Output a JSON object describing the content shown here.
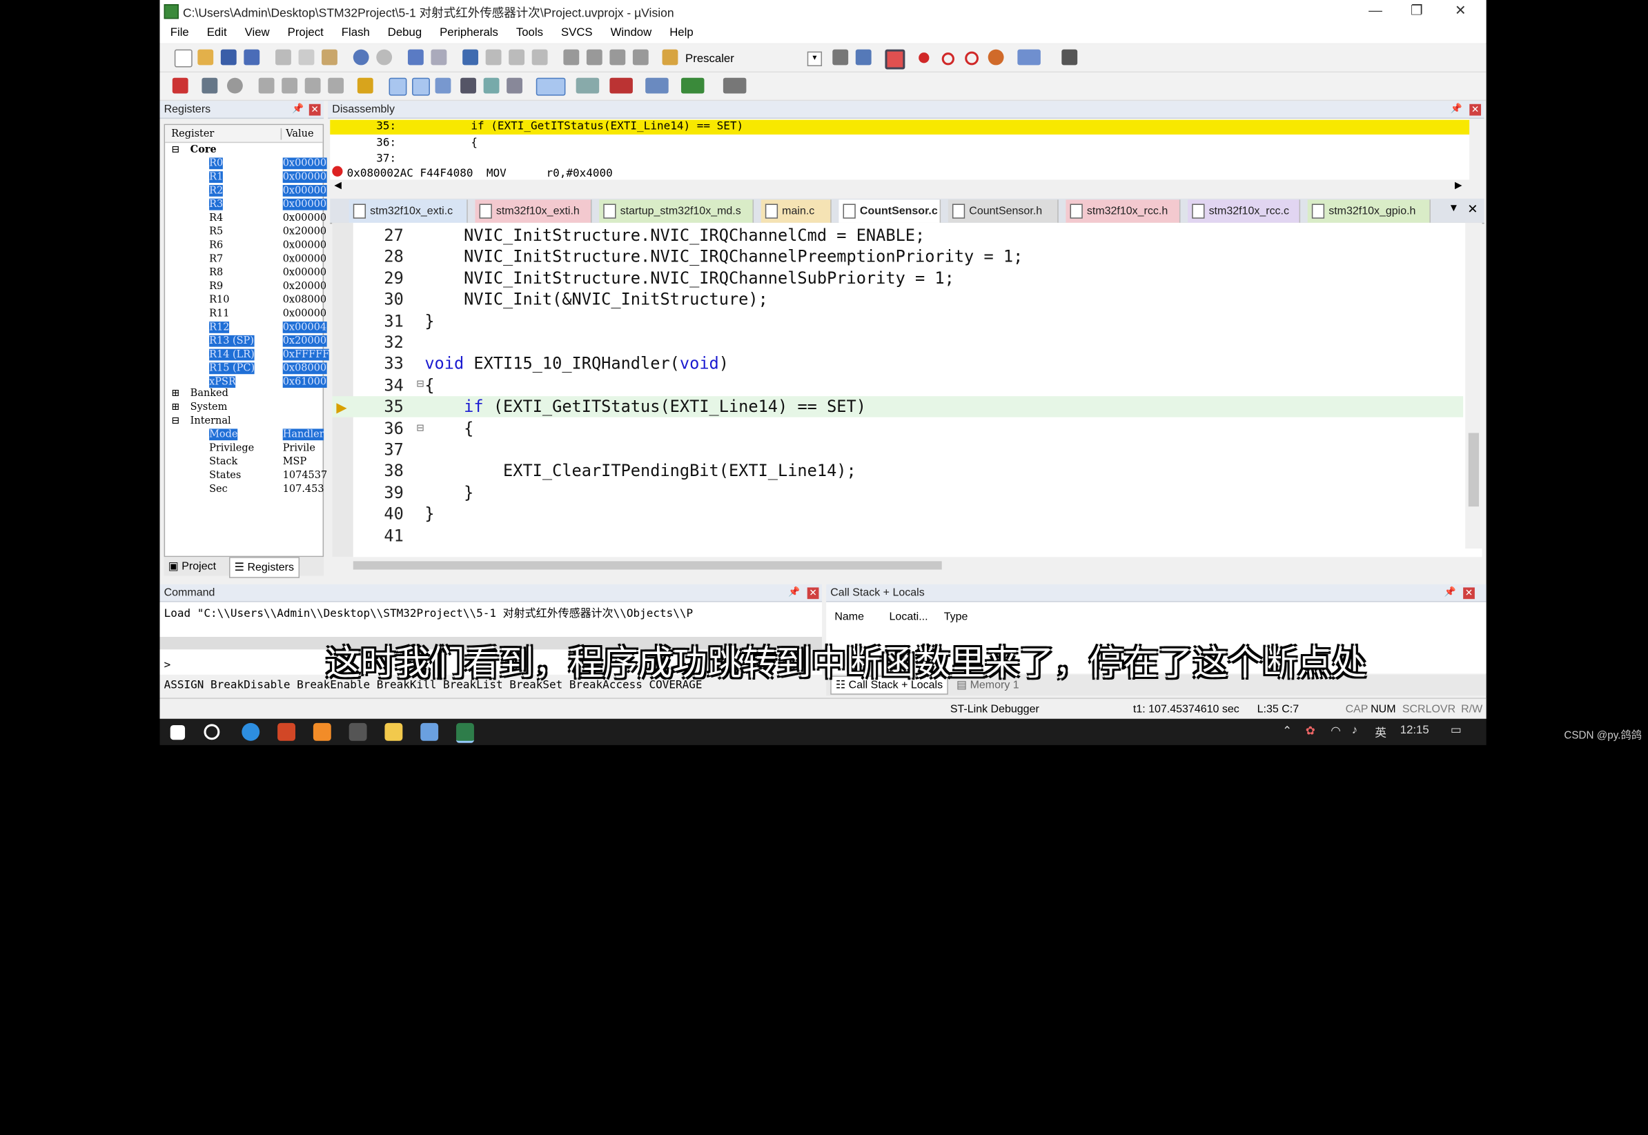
{
  "window": {
    "title": "C:\\Users\\Admin\\Desktop\\STM32Project\\5-1 对射式红外传感器计次\\Project.uvprojx - µVision",
    "minimize": "—",
    "maximize": "❐",
    "close": "✕"
  },
  "menu": [
    "File",
    "Edit",
    "View",
    "Project",
    "Flash",
    "Debug",
    "Peripherals",
    "Tools",
    "SVCS",
    "Window",
    "Help"
  ],
  "toolbar": {
    "target_label": "Prescaler"
  },
  "registers": {
    "panel_title": "Registers",
    "col_register": "Register",
    "col_value": "Value",
    "core_label": "Core",
    "rows": [
      {
        "name": "R0",
        "value": "0x00000",
        "sel": true
      },
      {
        "name": "R1",
        "value": "0x00000",
        "sel": true
      },
      {
        "name": "R2",
        "value": "0x00000",
        "sel": true
      },
      {
        "name": "R3",
        "value": "0x00000",
        "sel": true
      },
      {
        "name": "R4",
        "value": "0x00000",
        "sel": false
      },
      {
        "name": "R5",
        "value": "0x20000",
        "sel": false
      },
      {
        "name": "R6",
        "value": "0x00000",
        "sel": false
      },
      {
        "name": "R7",
        "value": "0x00000",
        "sel": false
      },
      {
        "name": "R8",
        "value": "0x00000",
        "sel": false
      },
      {
        "name": "R9",
        "value": "0x20000",
        "sel": false
      },
      {
        "name": "R10",
        "value": "0x08000",
        "sel": false
      },
      {
        "name": "R11",
        "value": "0x00000",
        "sel": false
      },
      {
        "name": "R12",
        "value": "0x00004",
        "sel": true
      },
      {
        "name": "R13 (SP)",
        "value": "0x20000",
        "sel": true
      },
      {
        "name": "R14 (LR)",
        "value": "0xFFFFF",
        "sel": true
      },
      {
        "name": "R15 (PC)",
        "value": "0x08000",
        "sel": true
      },
      {
        "name": "xPSR",
        "value": "0x61000",
        "sel": true
      }
    ],
    "groups": [
      "Banked",
      "System",
      "Internal"
    ],
    "internal": [
      {
        "name": "Mode",
        "value": "Handler",
        "sel": true
      },
      {
        "name": "Privilege",
        "value": "Privile",
        "sel": false
      },
      {
        "name": "Stack",
        "value": "MSP",
        "sel": false
      },
      {
        "name": "States",
        "value": "1074537",
        "sel": false
      },
      {
        "name": "Sec",
        "value": "107.453",
        "sel": false
      }
    ],
    "tab_project": "Project",
    "tab_registers": "Registers"
  },
  "disassembly": {
    "panel_title": "Disassembly",
    "lines": [
      {
        "num": "35:",
        "text": "if (EXTI_GetITStatus(EXTI_Line14) == SET)"
      },
      {
        "num": "36:",
        "text": "{"
      },
      {
        "num": "37:",
        "text": ""
      }
    ],
    "asm": "0x080002AC F44F4080  MOV      r0,#0x4000"
  },
  "tabs": [
    "stm32f10x_exti.c",
    "stm32f10x_exti.h",
    "startup_stm32f10x_md.s",
    "main.c",
    "CountSensor.c",
    "CountSensor.h",
    "stm32f10x_rcc.h",
    "stm32f10x_rcc.c",
    "stm32f10x_gpio.h"
  ],
  "code": [
    {
      "n": "27",
      "t": "    NVIC_InitStructure.NVIC_IRQChannelCmd = ENABLE;"
    },
    {
      "n": "28",
      "t": "    NVIC_InitStructure.NVIC_IRQChannelPreemptionPriority = 1;"
    },
    {
      "n": "29",
      "t": "    NVIC_InitStructure.NVIC_IRQChannelSubPriority = 1;"
    },
    {
      "n": "30",
      "t": "    NVIC_Init(&NVIC_InitStructure);"
    },
    {
      "n": "31",
      "t": "}"
    },
    {
      "n": "32",
      "t": ""
    },
    {
      "n": "33",
      "t": "void EXTI15_10_IRQHandler(void)"
    },
    {
      "n": "34",
      "t": "{"
    },
    {
      "n": "35",
      "t": "    if (EXTI_GetITStatus(EXTI_Line14) == SET)"
    },
    {
      "n": "36",
      "t": "    {"
    },
    {
      "n": "37",
      "t": ""
    },
    {
      "n": "38",
      "t": "        EXTI_ClearITPendingBit(EXTI_Line14);"
    },
    {
      "n": "39",
      "t": "    }"
    },
    {
      "n": "40",
      "t": "}"
    },
    {
      "n": "41",
      "t": ""
    }
  ],
  "command": {
    "panel_title": "Command",
    "output": "Load \"C:\\\\Users\\\\Admin\\\\Desktop\\\\STM32Project\\\\5-1 对射式红外传感器计次\\\\Objects\\\\P",
    "prompt": ">",
    "keywords": "ASSIGN BreakDisable BreakEnable BreakKill BreakList BreakSet BreakAccess COVERAGE"
  },
  "callstack": {
    "panel_title": "Call Stack + Locals",
    "cols": [
      "Name",
      "Locati...",
      "Type"
    ],
    "tab_callstack": "Call Stack + Locals",
    "tab_memory": "Memory 1"
  },
  "status": {
    "debugger": "ST-Link Debugger",
    "time": "t1: 107.45374610 sec",
    "pos": "L:35 C:7",
    "caps": "CAP",
    "num": "NUM",
    "scrl": "SCRL",
    "ovr": "OVR",
    "rw": "R/W"
  },
  "subtitle": "这时我们看到，程序成功跳转到中断函数里来了，停在了这个断点处",
  "taskbar": {
    "ime": "英",
    "clock": "12:15"
  },
  "watermark": "CSDN @py.鸽鸽",
  "colors": {
    "highlight_line": "#f8e800",
    "current_line": "#e6f6e6",
    "selection": "#1f6fd6",
    "keyword": "#1a1ad0"
  }
}
